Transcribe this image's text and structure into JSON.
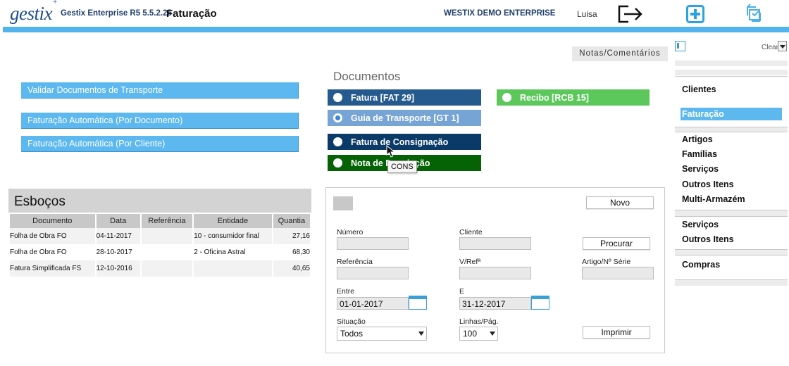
{
  "header": {
    "logo": "gestix",
    "logo_mark": "+",
    "app_version": "Gestix Enterprise R5 5.5.2.25",
    "module_title": "Faturação",
    "company": "WESTIX DEMO ENTERPRISE",
    "user": "Luisa",
    "icons": [
      "logout-icon",
      "add-icon",
      "sync-icon"
    ],
    "accent_color": "#52b4ee"
  },
  "actions": [
    {
      "label": "Validar Documentos de Transporte"
    },
    {
      "label": "Faturação Automática (Por Documento)"
    },
    {
      "label": "Faturação Automática (Por Cliente)"
    }
  ],
  "notes": {
    "label": "Notas/Comentários"
  },
  "documents": {
    "heading": "Documentos",
    "options": [
      {
        "label": "Fatura [FAT 29]",
        "color": "#255a8e",
        "checked": false
      },
      {
        "label": "Guia de Transporte [GT 1]",
        "color": "#76a4d5",
        "checked": true
      },
      {
        "label": "Fatura de Consignação",
        "color": "#0b3a68",
        "checked": false
      },
      {
        "label": "Nota de Devolução",
        "color": "#056305",
        "checked": false
      },
      {
        "label": "Recibo [RCB 15]",
        "color": "#5cc85c",
        "checked": false
      }
    ],
    "tooltip": "CONS"
  },
  "esbocos": {
    "title": "Esboços",
    "columns": [
      "Documento",
      "Data",
      "Referência",
      "Entidade",
      "Quantia"
    ],
    "rows": [
      [
        "Folha de Obra FO",
        "04-11-2017",
        "",
        "10 - consumidor final",
        "27,16"
      ],
      [
        "Folha de Obra FO",
        "28-10-2017",
        "",
        "2 - Oficina Astral",
        "68,30"
      ],
      [
        "Fatura Simplificada FS",
        "12-10-2016",
        "",
        "",
        "40,65"
      ]
    ]
  },
  "search": {
    "new_label": "Novo",
    "search_label": "Procurar",
    "print_label": "Imprimir",
    "numero_label": "Número",
    "numero_value": "",
    "cliente_label": "Cliente",
    "cliente_value": "",
    "referencia_label": "Referência",
    "referencia_value": "",
    "vref_label": "V/Refª",
    "vref_value": "",
    "artigo_label": "Artigo/Nº Série",
    "artigo_value": "",
    "entre_label": "Entre",
    "entre_value": "01-01-2017",
    "e_label": "E",
    "e_value": "31-12-2017",
    "situacao_label": "Situação",
    "situacao_value": "Todos",
    "linhas_label": "Linhas/Pág.",
    "linhas_value": "100"
  },
  "sidebar": {
    "clear_label": "Clear",
    "groups": [
      {
        "items": [
          {
            "label": "Clientes",
            "active": false
          },
          {
            "label": "Faturação",
            "active": true
          }
        ]
      },
      {
        "items": [
          {
            "label": "Artigos"
          },
          {
            "label": "Famílias"
          },
          {
            "label": "Serviços"
          },
          {
            "label": "Outros Itens"
          },
          {
            "label": "Multi-Armazém"
          }
        ]
      },
      {
        "items": [
          {
            "label": "Serviços"
          },
          {
            "label": "Outros Itens"
          }
        ]
      },
      {
        "items": [
          {
            "label": "Compras"
          }
        ]
      }
    ]
  }
}
